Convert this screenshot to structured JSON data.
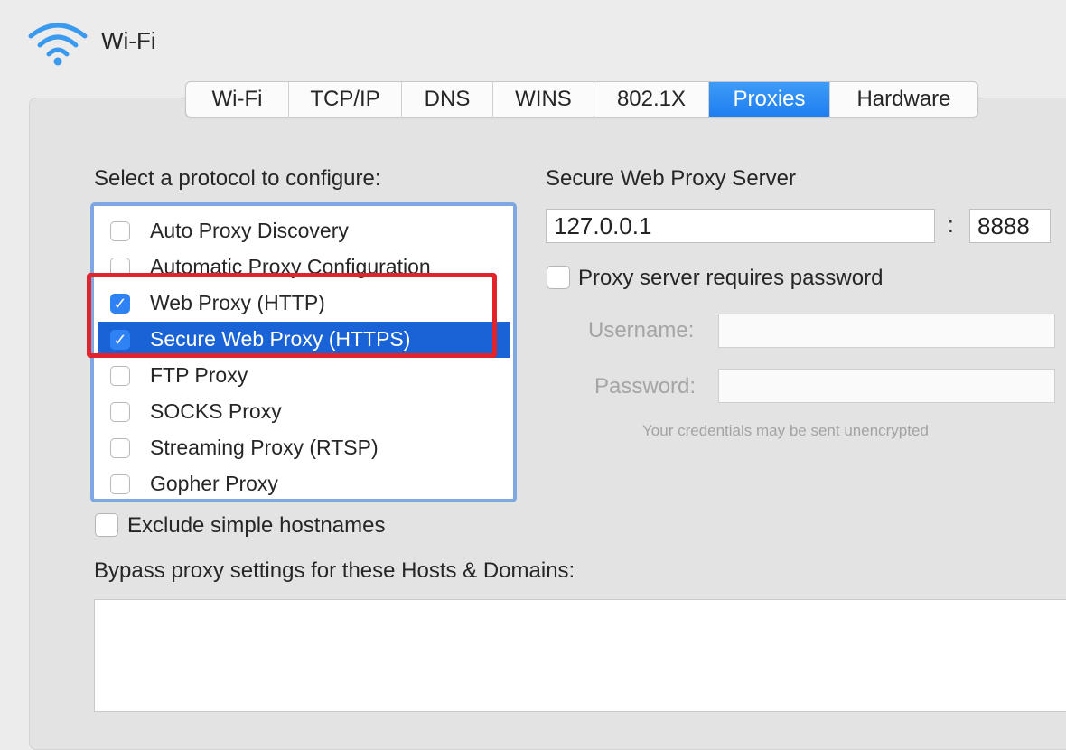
{
  "header": {
    "title": "Wi-Fi",
    "icon": "wifi-icon"
  },
  "tabs": [
    {
      "label": "Wi-Fi",
      "active": false
    },
    {
      "label": "TCP/IP",
      "active": false
    },
    {
      "label": "DNS",
      "active": false
    },
    {
      "label": "WINS",
      "active": false
    },
    {
      "label": "802.1X",
      "active": false
    },
    {
      "label": "Proxies",
      "active": true
    },
    {
      "label": "Hardware",
      "active": false
    }
  ],
  "protocols": {
    "heading": "Select a protocol to configure:",
    "items": [
      {
        "label": "Auto Proxy Discovery",
        "checked": false
      },
      {
        "label": "Automatic Proxy Configuration",
        "checked": false
      },
      {
        "label": "Web Proxy (HTTP)",
        "checked": true
      },
      {
        "label": "Secure Web Proxy (HTTPS)",
        "checked": true,
        "selected": true
      },
      {
        "label": "FTP Proxy",
        "checked": false
      },
      {
        "label": "SOCKS Proxy",
        "checked": false
      },
      {
        "label": "Streaming Proxy (RTSP)",
        "checked": false
      },
      {
        "label": "Gopher Proxy",
        "checked": false
      }
    ]
  },
  "server": {
    "heading": "Secure Web Proxy Server",
    "host": "127.0.0.1",
    "separator": ":",
    "port": "8888",
    "password_checkbox_label": "Proxy server requires password",
    "password_checkbox_checked": false,
    "username_label": "Username:",
    "password_label": "Password:",
    "username_value": "",
    "password_value": "",
    "hint": "Your credentials may be sent unencrypted"
  },
  "exclude": {
    "label": "Exclude simple hostnames",
    "checked": false
  },
  "bypass": {
    "label": "Bypass proxy settings for these Hosts & Domains:",
    "value": ""
  },
  "colors": {
    "accent": "#1a63d7",
    "tab_active": "#2a8af5",
    "highlight": "#e1242b"
  }
}
